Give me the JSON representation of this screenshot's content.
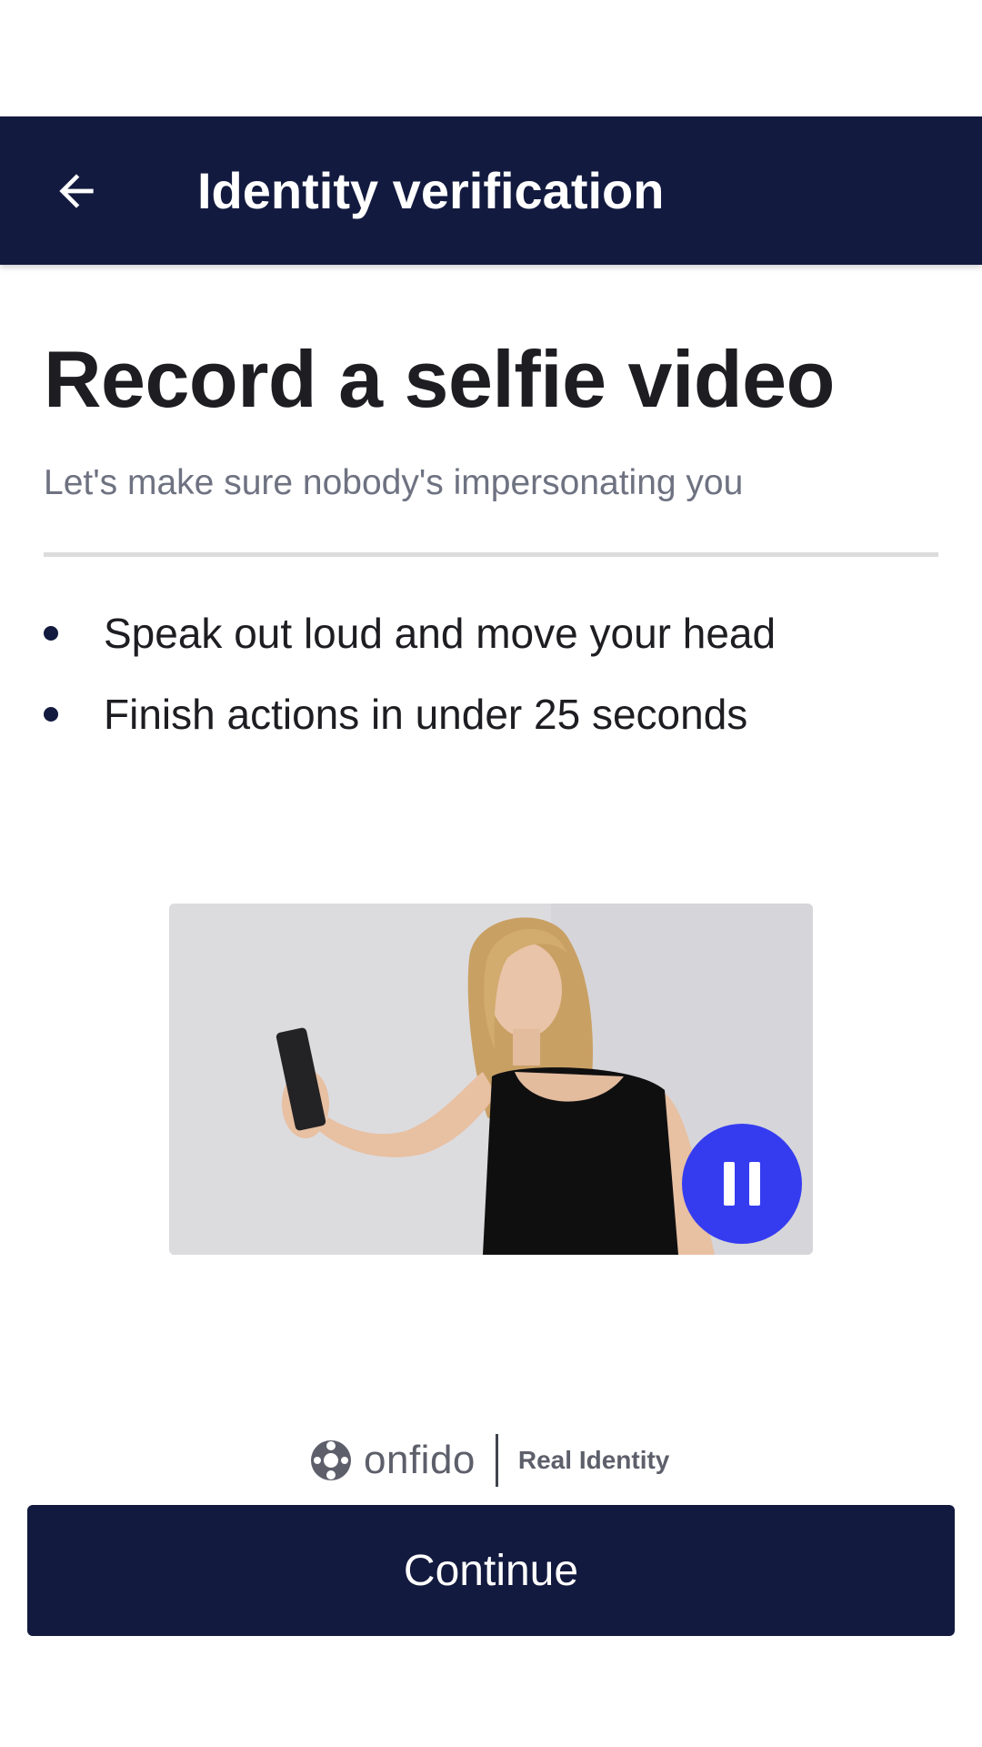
{
  "app_bar": {
    "title": "Identity verification",
    "back_icon": "arrow-left-icon"
  },
  "main": {
    "title": "Record a selfie video",
    "subtitle": "Let's make sure nobody's impersonating you",
    "bullets": [
      "Speak out loud and move your head",
      "Finish actions in under 25 seconds"
    ]
  },
  "video": {
    "control_icon": "pause-icon",
    "accent_color": "#353cf0"
  },
  "brand": {
    "wordmark": "onfido",
    "tagline": "Real Identity",
    "logo_icon": "onfido-logo-icon"
  },
  "footer": {
    "continue_label": "Continue"
  },
  "colors": {
    "primary": "#131a3f",
    "background": "#ffffff",
    "title_text": "#1d1d22",
    "subtitle_text": "#6e7281"
  }
}
